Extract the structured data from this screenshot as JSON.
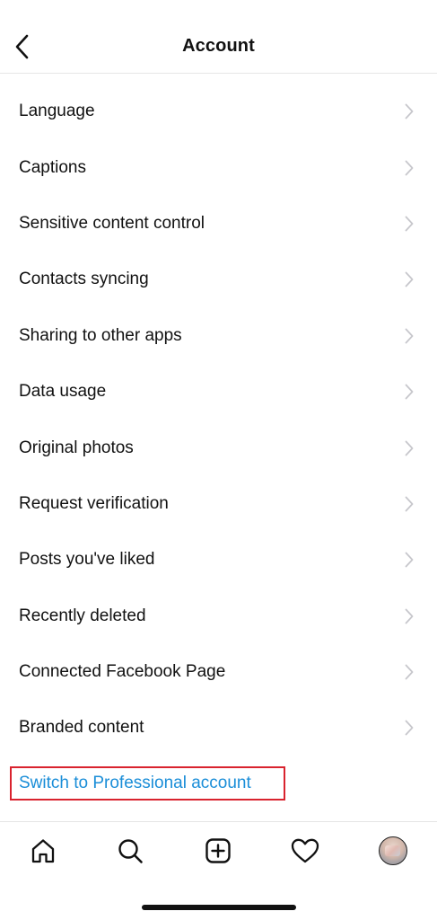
{
  "header": {
    "title": "Account"
  },
  "menu": {
    "items": [
      {
        "label": "Language"
      },
      {
        "label": "Captions"
      },
      {
        "label": "Sensitive content control"
      },
      {
        "label": "Contacts syncing"
      },
      {
        "label": "Sharing to other apps"
      },
      {
        "label": "Data usage"
      },
      {
        "label": "Original photos"
      },
      {
        "label": "Request verification"
      },
      {
        "label": "Posts you've liked"
      },
      {
        "label": "Recently deleted"
      },
      {
        "label": "Connected Facebook Page"
      },
      {
        "label": "Branded content"
      }
    ],
    "pro_link": "Switch to Professional account"
  },
  "colors": {
    "link": "#1b8ed8",
    "highlight_border": "#d9232e",
    "chevron": "#c7c7cc",
    "text": "#111111"
  },
  "tabbar": {
    "icons": [
      "home-icon",
      "search-icon",
      "new-post-icon",
      "activity-heart-icon",
      "profile-avatar"
    ]
  }
}
